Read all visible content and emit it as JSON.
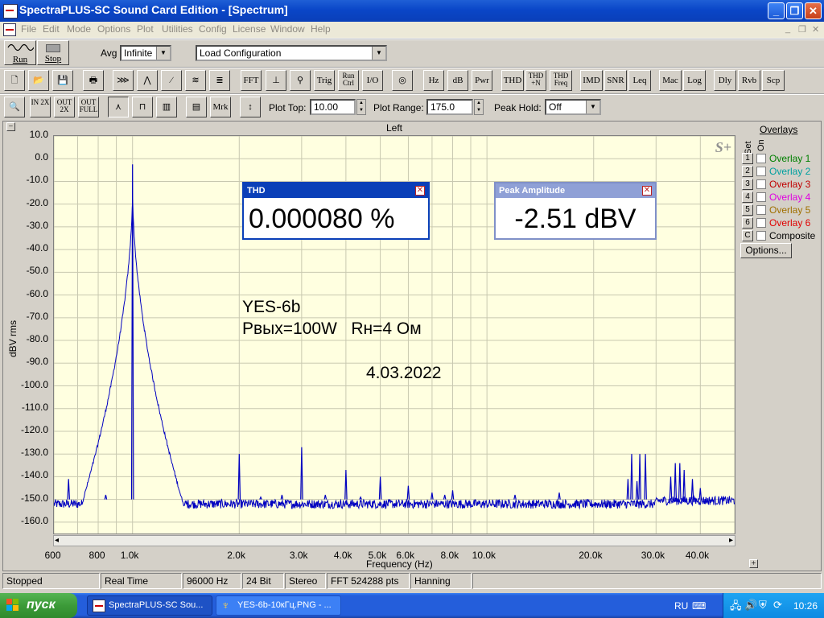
{
  "window": {
    "title": "SpectraPLUS-SC Sound Card Edition - [Spectrum]",
    "minimize": "_",
    "restore": "❐",
    "close": "✕"
  },
  "menu": [
    "File",
    "Edit",
    "Mode",
    "Options",
    "Plot",
    "Utilities",
    "Config",
    "License",
    "Window",
    "Help"
  ],
  "toolbar1": {
    "run_label": "Run",
    "stop_label": "Stop",
    "avg_label": "Avg",
    "avg_value": "Infinite",
    "config_value": "Load Configuration"
  },
  "toolbar2": {
    "buttons": [
      "FFT",
      "Trig",
      "Run Ctrl",
      "I/O",
      "Hz",
      "dB",
      "Pwr",
      "THD",
      "THD +N",
      "THD Freq",
      "IMD",
      "SNR",
      "Leq",
      "Mac",
      "Log",
      "Dly",
      "Rvb",
      "Scp"
    ]
  },
  "toolbar3": {
    "mrk_label": "Mrk",
    "plot_top_label": "Plot Top:",
    "plot_top_value": "10.00",
    "plot_range_label": "Plot Range:",
    "plot_range_value": "175.0",
    "peak_hold_label": "Peak Hold:",
    "peak_hold_value": "Off",
    "zoom_in_label": "IN 2X",
    "zoom_out_label": "OUT 2X",
    "zoom_full_label": "OUT FULL"
  },
  "plot": {
    "channel_title": "Left",
    "collapse_btn": "−",
    "logo": "S+",
    "expand_btn": "+",
    "scroll_left": "◂",
    "scroll_right": "▸"
  },
  "popups": {
    "thd": {
      "title": "THD",
      "value": "0.000080 %"
    },
    "peak": {
      "title": "Peak Amplitude",
      "value": "-2.51 dBV"
    }
  },
  "annotation": {
    "line1": "YES-6b",
    "line2": "Pвых=100W   Rн=4 Ом",
    "line3": "4.03.2022"
  },
  "overlays": {
    "title": "Overlays",
    "set_label": "Set",
    "on_label": "On",
    "items": [
      {
        "set": "1",
        "label": "Overlay 1",
        "color": "#008000"
      },
      {
        "set": "2",
        "label": "Overlay 2",
        "color": "#00a0a0"
      },
      {
        "set": "3",
        "label": "Overlay 3",
        "color": "#c00000"
      },
      {
        "set": "4",
        "label": "Overlay 4",
        "color": "#e000e0"
      },
      {
        "set": "5",
        "label": "Overlay 5",
        "color": "#a07000"
      },
      {
        "set": "6",
        "label": "Overlay 6",
        "color": "#e00000"
      },
      {
        "set": "C",
        "label": "Composite",
        "color": "#000000"
      }
    ],
    "options_label": "Options..."
  },
  "status": [
    "Stopped",
    "Real Time",
    "96000 Hz",
    "24 Bit",
    "Stereo",
    "FFT 524288 pts",
    "Hanning"
  ],
  "taskbar": {
    "start": "пуск",
    "items": [
      "SpectraPLUS-SC Sou...",
      "YES-6b-10кГц.PNG - ..."
    ],
    "lang": "RU",
    "clock": "10:26"
  },
  "chart_data": {
    "type": "line",
    "title": "Left",
    "xlabel": "Frequency (Hz)",
    "ylabel": "dBV rms",
    "xscale": "log",
    "xlim": [
      600,
      50000
    ],
    "ylim": [
      -165,
      10
    ],
    "x_ticks": [
      600,
      800,
      1000,
      2000,
      3000,
      4000,
      5000,
      6000,
      8000,
      10000,
      20000,
      30000,
      40000
    ],
    "x_tick_labels": [
      "600",
      "800",
      "1.0k",
      "2.0k",
      "3.0k",
      "4.0k",
      "5.0k",
      "6.0k",
      "8.0k",
      "10.0k",
      "20.0k",
      "30.0k",
      "40.0k"
    ],
    "y_ticks": [
      10,
      0,
      -10,
      -20,
      -30,
      -40,
      -50,
      -60,
      -70,
      -80,
      -90,
      -100,
      -110,
      -120,
      -130,
      -140,
      -150,
      -160
    ],
    "y_tick_labels": [
      "10.0",
      "0.0",
      "-10.0",
      "-20.0",
      "-30.0",
      "-40.0",
      "-50.0",
      "-60.0",
      "-70.0",
      "-80.0",
      "-90.0",
      "-100.0",
      "-110.0",
      "-120.0",
      "-130.0",
      "-140.0",
      "-150.0",
      "-160.0"
    ],
    "grid": true,
    "line_color": "#0000c0",
    "noise_floor": -152,
    "series": [
      {
        "peaks": [
          {
            "x": 660,
            "y": -141
          },
          {
            "x": 840,
            "y": -148
          },
          {
            "x": 1000,
            "y": -2.5
          },
          {
            "x": 2000,
            "y": -130
          },
          {
            "x": 2300,
            "y": -149
          },
          {
            "x": 2640,
            "y": -148
          },
          {
            "x": 3000,
            "y": -127
          },
          {
            "x": 3500,
            "y": -148
          },
          {
            "x": 4000,
            "y": -137
          },
          {
            "x": 4400,
            "y": -149
          },
          {
            "x": 5000,
            "y": -140
          },
          {
            "x": 6000,
            "y": -144
          },
          {
            "x": 7000,
            "y": -147
          },
          {
            "x": 7600,
            "y": -148
          },
          {
            "x": 8000,
            "y": -146
          },
          {
            "x": 12000,
            "y": -148
          },
          {
            "x": 16000,
            "y": -147
          },
          {
            "x": 25000,
            "y": -141
          },
          {
            "x": 25600,
            "y": -130
          },
          {
            "x": 26500,
            "y": -142
          },
          {
            "x": 27000,
            "y": -130
          },
          {
            "x": 28000,
            "y": -130
          },
          {
            "x": 33000,
            "y": -140
          },
          {
            "x": 34000,
            "y": -134
          },
          {
            "x": 35000,
            "y": -134
          },
          {
            "x": 36000,
            "y": -137
          },
          {
            "x": 38000,
            "y": -141
          },
          {
            "x": 40000,
            "y": -145
          }
        ]
      }
    ]
  }
}
